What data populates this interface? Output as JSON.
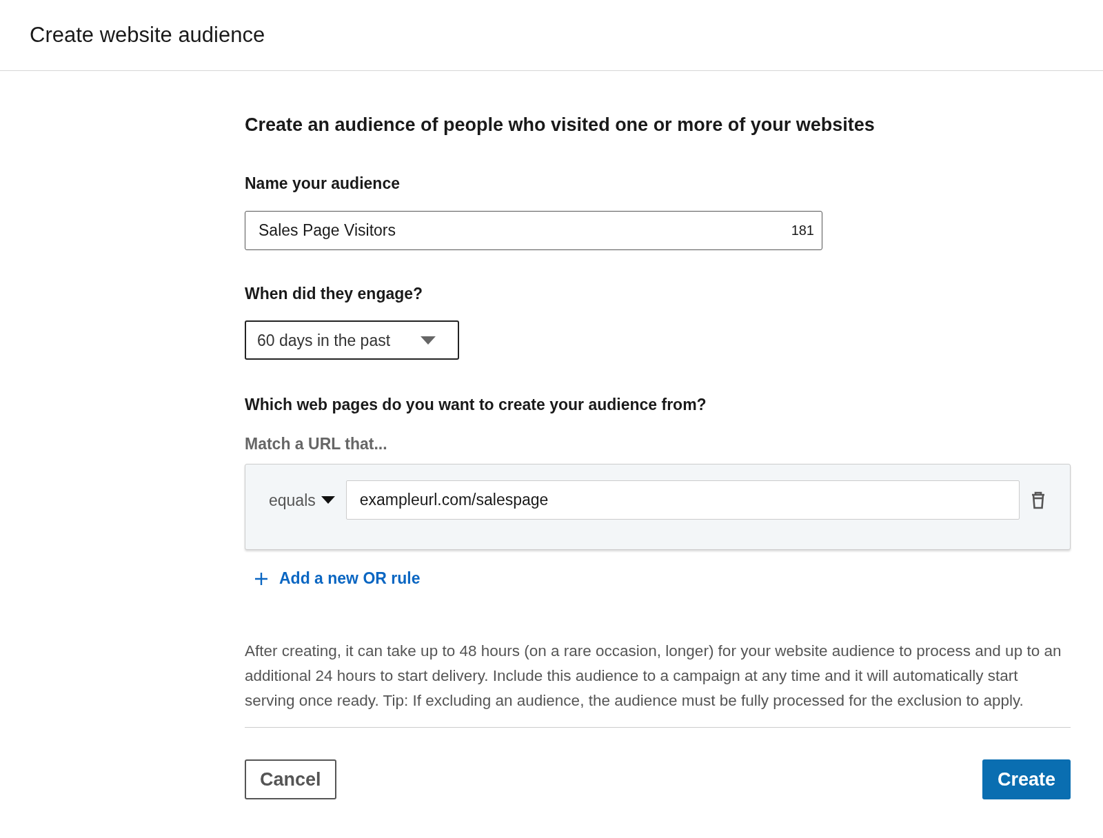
{
  "header": {
    "title": "Create website audience"
  },
  "heading": "Create an audience of people who visited one or more of your websites",
  "name_field": {
    "label": "Name your audience",
    "value": "Sales Page Visitors",
    "counter": "181"
  },
  "engagement": {
    "label": "When did they engage?",
    "value": "60 days in the past"
  },
  "pages": {
    "label": "Which web pages do you want to create your audience from?",
    "sublabel": "Match a URL that...",
    "rules": [
      {
        "operator": "equals",
        "value": "exampleurl.com/salespage"
      }
    ],
    "add_rule": "Add a new OR rule"
  },
  "note": "After creating, it can take up to 48 hours (on a rare occasion, longer) for your website audience to process and up to an additional 24 hours to start delivery. Include this audience to a campaign at any time and it will automatically start serving once ready. Tip: If excluding an audience, the audience must be fully processed for the exclusion to apply.",
  "buttons": [
    {
      "kind": "secondary",
      "label": "Cancel"
    },
    {
      "kind": "primary",
      "label": "Create"
    }
  ]
}
